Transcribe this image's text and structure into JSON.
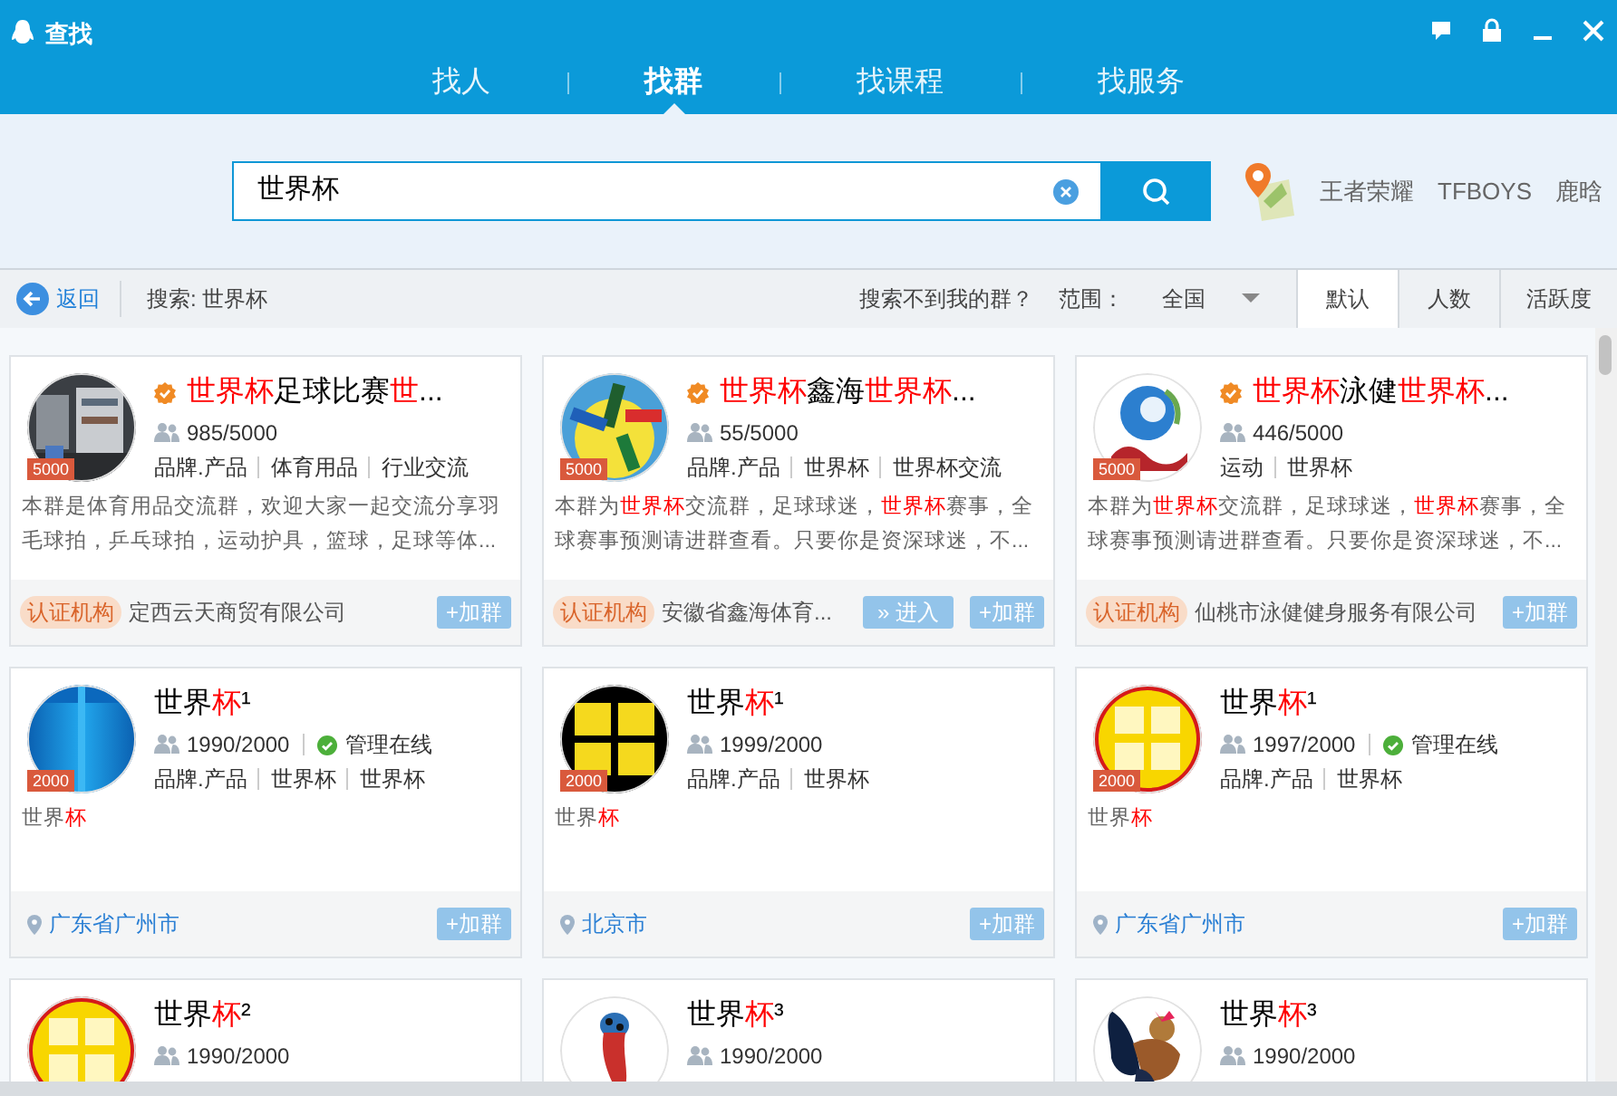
{
  "window": {
    "title": "查找"
  },
  "nav_tabs": [
    {
      "label": "找人",
      "selected": false
    },
    {
      "label": "找群",
      "selected": true
    },
    {
      "label": "找课程",
      "selected": false
    },
    {
      "label": "找服务",
      "selected": false
    }
  ],
  "search": {
    "value": "世界杯"
  },
  "hot_keywords": [
    "王者荣耀",
    "TFBOYS",
    "鹿晗"
  ],
  "filter_bar": {
    "back": "返回",
    "query": "搜索: 世界杯",
    "help_link": "搜索不到我的群？",
    "scope_label": "范围：",
    "scope_value": "全国"
  },
  "sort_tabs": [
    {
      "label": "默认",
      "selected": true
    },
    {
      "label": "人数",
      "selected": false
    },
    {
      "label": "活跃度",
      "selected": false
    }
  ],
  "groups": [
    {
      "avatar": {
        "kind": "picture"
      },
      "capacity_badge": "5000",
      "verified": true,
      "name": [
        {
          "text": "世界杯",
          "highlight": true
        },
        {
          "text": "足球比赛",
          "highlight": false
        },
        {
          "text": "世",
          "highlight": true
        },
        {
          "text": "...",
          "highlight": false
        }
      ],
      "members": "985/5000",
      "admin_online": false,
      "tags": [
        "品牌.产品",
        "体育用品",
        "行业交流"
      ],
      "description": [
        {
          "text": "本群是体育用品交流群，欢迎大家一起交流分享羽毛球拍，乒乓球拍，运动护具，篮球，足球等体...",
          "highlight": false
        }
      ],
      "footer": {
        "kind": "org",
        "badge": "认证机构",
        "text": "定西云天商贸有限公司"
      },
      "buttons": [
        {
          "kind": "join",
          "label": "+加群"
        }
      ]
    },
    {
      "avatar": {
        "kind": "picture"
      },
      "capacity_badge": "5000",
      "verified": true,
      "name": [
        {
          "text": "世界杯",
          "highlight": true
        },
        {
          "text": "鑫海",
          "highlight": false
        },
        {
          "text": "世界杯",
          "highlight": true
        },
        {
          "text": "...",
          "highlight": false
        }
      ],
      "members": "55/5000",
      "admin_online": false,
      "tags": [
        "品牌.产品",
        "世界杯",
        "世界杯交流"
      ],
      "description": [
        {
          "text": "本群为",
          "highlight": false
        },
        {
          "text": "世界杯",
          "highlight": true
        },
        {
          "text": "交流群，足球球迷，",
          "highlight": false
        },
        {
          "text": "世界杯",
          "highlight": true
        },
        {
          "text": "赛事，全球赛事预测请进群查看。只要你是资深球迷，不...",
          "highlight": false
        }
      ],
      "footer": {
        "kind": "org",
        "badge": "认证机构",
        "text": "安徽省鑫海体育..."
      },
      "buttons": [
        {
          "kind": "enter",
          "label": "» 进入"
        },
        {
          "kind": "join",
          "label": "+加群"
        }
      ]
    },
    {
      "avatar": {
        "kind": "picture"
      },
      "capacity_badge": "5000",
      "verified": true,
      "name": [
        {
          "text": "世界杯",
          "highlight": true
        },
        {
          "text": "泳健",
          "highlight": false
        },
        {
          "text": "世界杯",
          "highlight": true
        },
        {
          "text": "...",
          "highlight": false
        }
      ],
      "members": "446/5000",
      "admin_online": false,
      "tags": [
        "运动",
        "世界杯"
      ],
      "description": [
        {
          "text": "本群为",
          "highlight": false
        },
        {
          "text": "世界杯",
          "highlight": true
        },
        {
          "text": "交流群，足球球迷，",
          "highlight": false
        },
        {
          "text": "世界杯",
          "highlight": true
        },
        {
          "text": "赛事，全球赛事预测请进群查看。只要你是资深球迷，不...",
          "highlight": false
        }
      ],
      "footer": {
        "kind": "org",
        "badge": "认证机构",
        "text": "仙桃市泳健健身服务有限公司"
      },
      "buttons": [
        {
          "kind": "join",
          "label": "+加群"
        }
      ]
    },
    {
      "avatar": {
        "kind": "picture"
      },
      "capacity_badge": "2000",
      "verified": false,
      "name": [
        {
          "text": "世界",
          "highlight": false
        },
        {
          "text": "杯",
          "highlight": true
        },
        {
          "text": "¹",
          "highlight": false
        }
      ],
      "members": "1990/2000",
      "admin_online": true,
      "admin_label": "管理在线",
      "tags": [
        "品牌.产品",
        "世界杯",
        "世界杯"
      ],
      "description": [
        {
          "text": "世界",
          "highlight": false
        },
        {
          "text": "杯",
          "highlight": true
        }
      ],
      "footer": {
        "kind": "location",
        "text": "广东省广州市"
      },
      "buttons": [
        {
          "kind": "join",
          "label": "+加群"
        }
      ]
    },
    {
      "avatar": {
        "kind": "picture"
      },
      "capacity_badge": "2000",
      "verified": false,
      "name": [
        {
          "text": "世界",
          "highlight": false
        },
        {
          "text": "杯",
          "highlight": true
        },
        {
          "text": "¹",
          "highlight": false
        }
      ],
      "members": "1999/2000",
      "admin_online": false,
      "tags": [
        "品牌.产品",
        "世界杯"
      ],
      "description": [
        {
          "text": "世界",
          "highlight": false
        },
        {
          "text": "杯",
          "highlight": true
        }
      ],
      "footer": {
        "kind": "location",
        "text": "北京市"
      },
      "buttons": [
        {
          "kind": "join",
          "label": "+加群"
        }
      ]
    },
    {
      "avatar": {
        "kind": "picture"
      },
      "capacity_badge": "2000",
      "verified": false,
      "name": [
        {
          "text": "世界",
          "highlight": false
        },
        {
          "text": "杯",
          "highlight": true
        },
        {
          "text": "¹",
          "highlight": false
        }
      ],
      "members": "1997/2000",
      "admin_online": true,
      "admin_label": "管理在线",
      "tags": [
        "品牌.产品",
        "世界杯"
      ],
      "description": [
        {
          "text": "世界",
          "highlight": false
        },
        {
          "text": "杯",
          "highlight": true
        }
      ],
      "footer": {
        "kind": "location",
        "text": "广东省广州市"
      },
      "buttons": [
        {
          "kind": "join",
          "label": "+加群"
        }
      ]
    },
    {
      "avatar": {
        "kind": "picture"
      },
      "verified": false,
      "name": [
        {
          "text": "世界",
          "highlight": false
        },
        {
          "text": "杯",
          "highlight": true
        },
        {
          "text": "²",
          "highlight": false
        }
      ],
      "members": "1990/2000",
      "admin_online": false
    },
    {
      "avatar": {
        "kind": "picture"
      },
      "verified": false,
      "name": [
        {
          "text": "世界",
          "highlight": false
        },
        {
          "text": "杯",
          "highlight": true
        },
        {
          "text": "³",
          "highlight": false
        }
      ],
      "members": "1990/2000",
      "admin_online": false
    },
    {
      "avatar": {
        "kind": "picture"
      },
      "verified": false,
      "name": [
        {
          "text": "世界",
          "highlight": false
        },
        {
          "text": "杯",
          "highlight": true
        },
        {
          "text": "³",
          "highlight": false
        }
      ],
      "members": "1990/2000",
      "admin_online": false
    }
  ]
}
